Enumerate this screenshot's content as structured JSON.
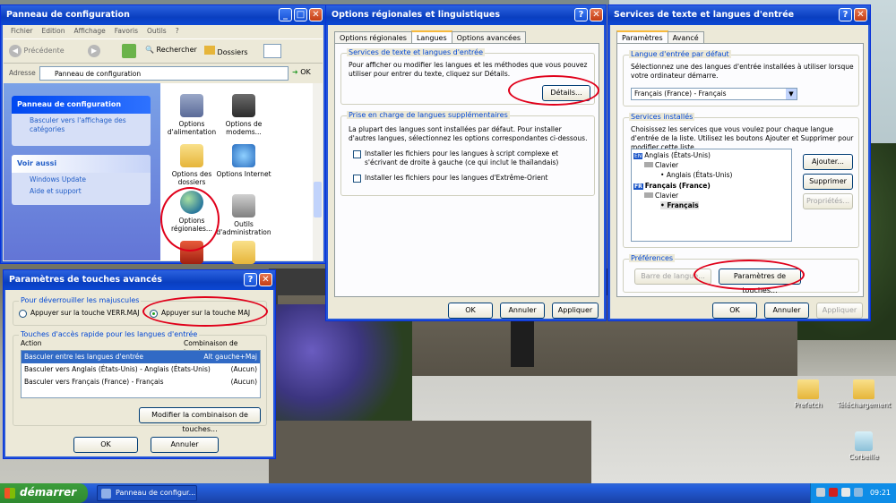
{
  "desktop": {
    "icons": [
      {
        "label": "Prefetch"
      },
      {
        "label": "Téléchargement"
      },
      {
        "label": "Corbeille"
      }
    ]
  },
  "control_panel": {
    "title": "Panneau de configuration",
    "menu": [
      "Fichier",
      "Edition",
      "Affichage",
      "Favoris",
      "Outils",
      "?"
    ],
    "toolbar": {
      "back": "Précédente",
      "search": "Rechercher",
      "folders": "Dossiers"
    },
    "address": {
      "label": "Adresse",
      "value": "Panneau de configuration",
      "go": "OK"
    },
    "task_box": {
      "title": "Panneau de configuration",
      "link": "Basculer vers l'affichage des catégories"
    },
    "see_also": {
      "title": "Voir aussi",
      "links": [
        "Windows Update",
        "Aide et support"
      ]
    },
    "items": [
      {
        "label": "Options d'alimentation"
      },
      {
        "label": "Options de modems..."
      },
      {
        "label": "Options des dossiers"
      },
      {
        "label": "Options Internet"
      },
      {
        "label": "Options régionales..."
      },
      {
        "label": "Outils d'administration"
      }
    ]
  },
  "regional": {
    "title": "Options régionales et linguistiques",
    "tabs": [
      "Options régionales",
      "Langues",
      "Options avancées"
    ],
    "group1": {
      "title": "Services de texte et langues d'entrée",
      "text": "Pour afficher ou modifier les langues et les méthodes que vous pouvez utiliser pour entrer du texte, cliquez sur Détails.",
      "button": "Détails..."
    },
    "group2": {
      "title": "Prise en charge de langues supplémentaires",
      "text": "La plupart des langues sont installées par défaut. Pour installer d'autres langues, sélectionnez les options correspondantes ci-dessous.",
      "chk1": "Installer les fichiers pour les langues à script complexe et s'écrivant de droite à gauche (ce qui inclut le thaïlandais)",
      "chk2": "Installer les fichiers pour les langues d'Extrême-Orient"
    },
    "buttons": {
      "ok": "OK",
      "cancel": "Annuler",
      "apply": "Appliquer"
    }
  },
  "services": {
    "title": "Services de texte et langues d'entrée",
    "tabs": [
      "Paramètres",
      "Avancé"
    ],
    "default_group": {
      "title": "Langue d'entrée par défaut",
      "text": "Sélectionnez une des langues d'entrée installées à utiliser lorsque votre ordinateur démarre.",
      "select": "Français (France) - Français"
    },
    "installed_group": {
      "title": "Services installés",
      "text": "Choisissez les services que vous voulez pour chaque langue d'entrée de la liste. Utilisez les boutons Ajouter et Supprimer pour modifier cette liste."
    },
    "tree": {
      "en_badge": "EN",
      "en_lang": "Anglais (États-Unis)",
      "en_kb": "Clavier",
      "en_item": "Anglais (États-Unis)",
      "fr_badge": "FR",
      "fr_lang": "Français (France)",
      "fr_kb": "Clavier",
      "fr_item": "Français"
    },
    "side_buttons": {
      "add": "Ajouter...",
      "remove": "Supprimer",
      "props": "Propriétés..."
    },
    "prefs": {
      "title": "Préférences",
      "lang_bar": "Barre de langue...",
      "key_settings": "Paramètres de touches..."
    },
    "buttons": {
      "ok": "OK",
      "cancel": "Annuler",
      "apply": "Appliquer"
    }
  },
  "advanced": {
    "title": "Paramètres de touches avancés",
    "caps_group": {
      "title": "Pour déverrouiller les majuscules",
      "opt1": "Appuyer sur la touche VERR.MAJ",
      "opt2": "Appuyer sur la touche MAJ"
    },
    "hotkeys_group": {
      "title": "Touches d'accès rapide pour les langues d'entrée",
      "col1": "Action",
      "col2": "Combinaison de touches"
    },
    "rows": [
      {
        "action": "Basculer entre les langues d'entrée",
        "keys": "Alt gauche+Maj"
      },
      {
        "action": "Basculer vers Anglais (États-Unis) - Anglais (États-Unis)",
        "keys": "(Aucun)"
      },
      {
        "action": "Basculer vers Français (France) - Français",
        "keys": "(Aucun)"
      }
    ],
    "modify": "Modifier la combinaison de touches...",
    "buttons": {
      "ok": "OK",
      "cancel": "Annuler"
    }
  },
  "taskbar": {
    "start": "démarrer",
    "task": "Panneau de configur...",
    "clock": "09:21"
  },
  "colors": {
    "xp_blue": "#0a3fc0",
    "annotation_red": "#e0001a",
    "start_green": "#2f8a2f"
  }
}
